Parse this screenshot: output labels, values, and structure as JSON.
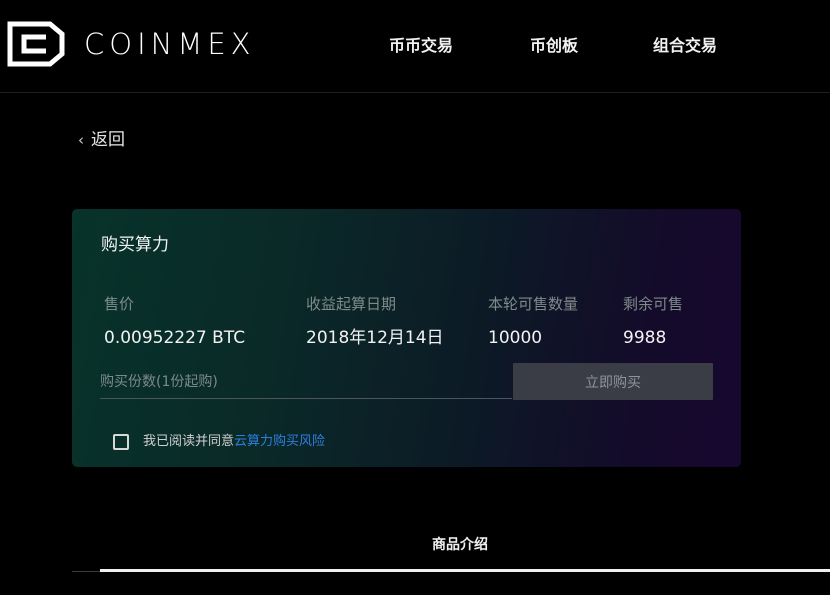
{
  "brand": {
    "name": "COINMEX",
    "logo_icon": "coinmex-logo-icon"
  },
  "nav": {
    "items": [
      "币币交易",
      "币创板",
      "组合交易"
    ]
  },
  "back": {
    "label": "返回",
    "icon": "chevron-left-icon"
  },
  "purchase": {
    "title": "购买算力",
    "columns": [
      {
        "label": "售价",
        "value": "0.00952227 BTC"
      },
      {
        "label": "收益起算日期",
        "value": "2018年12月14日"
      },
      {
        "label": "本轮可售数量",
        "value": "10000"
      },
      {
        "label": "剩余可售",
        "value": "9988"
      }
    ],
    "quantity_placeholder": "购买份数(1份起购)",
    "buy_label": "立即购买",
    "agree_text": "我已阅读并同意",
    "agree_link": "云算力购买风险"
  },
  "tabs": {
    "items": [
      "商品介绍"
    ]
  },
  "colors": {
    "link": "#2e7ee0",
    "background": "#000000",
    "button_disabled": "#3a3d45"
  }
}
